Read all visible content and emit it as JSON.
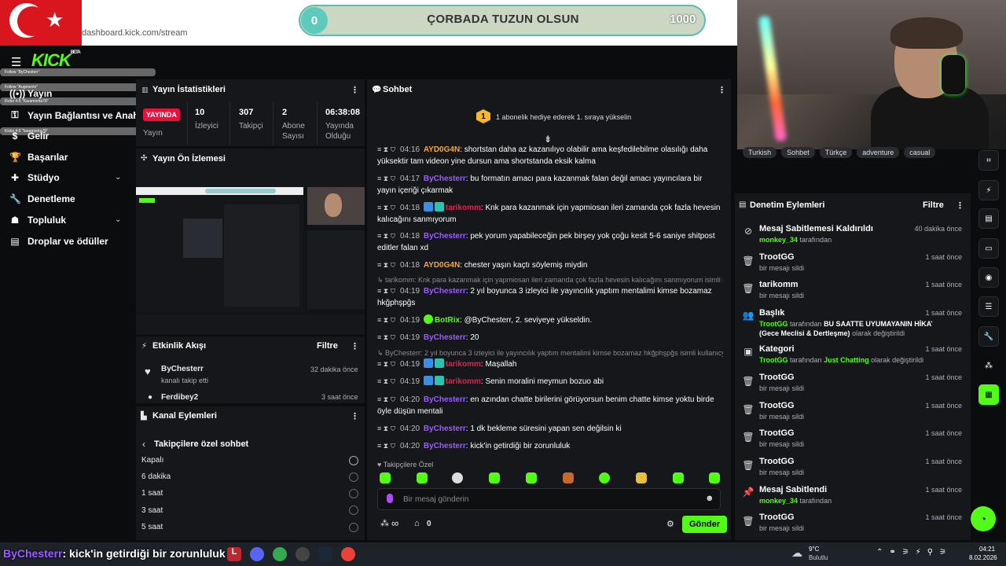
{
  "browser": {
    "url": "dashboard.kick.com/stream"
  },
  "goal": {
    "min": "0",
    "max": "1000",
    "title": "ÇORBADA TUZUN OLSUN"
  },
  "alerts": [
    "Follow \"ByChesterr\"",
    "Follow \"Augmentx\"",
    "Kicks 4-5 \"Karamonta78\"",
    "Kicks 4-5 \"karamonta78\""
  ],
  "nav": {
    "logo": "KICK",
    "logo_beta": "BETA",
    "items": [
      {
        "label": "Yayın"
      },
      {
        "label": "Yayın Bağlantısı ve Anahtarı"
      },
      {
        "label": "Gelir"
      },
      {
        "label": "Başarılar"
      },
      {
        "label": "Stüdyo"
      },
      {
        "label": "Denetleme"
      },
      {
        "label": "Topluluk"
      },
      {
        "label": "Droplar ve ödüller"
      }
    ]
  },
  "stats": {
    "title": "Yayın İstatistikleri",
    "live_badge": "YAYINDA",
    "status_label": "Yayın",
    "viewers": {
      "value": "10",
      "label": "İzleyici"
    },
    "followers": {
      "value": "307",
      "label": "Takipçi"
    },
    "subs": {
      "value": "2",
      "label": "Abone Sayısı"
    },
    "uptime": {
      "value": "06:38:08",
      "label": "Yayında Olduğu"
    }
  },
  "preview": {
    "title": "Yayın Ön İzlemesi"
  },
  "activity": {
    "title": "Etkinlik Akışı",
    "filter": "Filtre",
    "items": [
      {
        "user": "ByChesterr",
        "desc": "kanalı takip etti",
        "time": "32 dakika önce"
      },
      {
        "user": "Ferdibey2",
        "desc": "",
        "time": "3 saat önce"
      }
    ]
  },
  "kanal": {
    "title": "Kanal Eylemleri",
    "back": "Takipçilere özel sohbet",
    "options": [
      "Kapalı",
      "6 dakika",
      "1 saat",
      "3 saat",
      "5 saat"
    ]
  },
  "chat": {
    "title": "Sohbet",
    "gift_rank": "1",
    "gift_text": "1 abonelik hediye ederek 1. sıraya yükselin",
    "messages": [
      {
        "time": "04:16",
        "user": "AYD0G4N",
        "text": "shortstan daha az kazanılıyo olabilir ama keşfedilebilme olasılığı daha yüksektir tam videon yine dursun ama shortstanda eksik kalma"
      },
      {
        "time": "04:17",
        "user": "ByChesterr",
        "text": "bu formatın amacı para kazanmak falan değil amacı yayıncılara bir yayın içeriği çıkarmak"
      },
      {
        "time": "04:18",
        "user": "tarikomm",
        "text": "Knk para kazanmak için yapmiosan ileri zamanda çok fazla hevesin kalıcağını sanmıyorum"
      },
      {
        "time": "04:18",
        "user": "ByChesterr",
        "text": "pek yorum yapabileceğin pek birşey yok çoğu kesit 5-6 saniye shitpost editler falan xd"
      },
      {
        "time": "04:18",
        "user": "AYD0G4N",
        "text": "chester yaşın kaçtı söylemiş miydin"
      },
      {
        "time": "04:19",
        "user": "ByChesterr",
        "text": "2 yıl boyunca 3 izleyici ile yayıncılık yaptım mentalimi kimse bozamaz hkğphşpğs"
      },
      {
        "time": "04:19",
        "user": "BotRix",
        "text": "@ByChesterr, 2. seviyeye yükseldin."
      },
      {
        "time": "04:19",
        "user": "ByChesterr",
        "text": "20"
      },
      {
        "time": "04:19",
        "user": "tarikomm",
        "text": "Maşallah"
      },
      {
        "time": "04:19",
        "user": "tarikomm",
        "text": "Senin moralini meymun bozuo abi"
      },
      {
        "time": "04:20",
        "user": "ByChesterr",
        "text": "en azından chatte birilerini görüyorsun benim chatte kimse yoktu birde öyle düşün mentali"
      },
      {
        "time": "04:20",
        "user": "ByChesterr",
        "text": "1 dk bekleme süresini yapan sen değilsin ki"
      },
      {
        "time": "04:20",
        "user": "ByChesterr",
        "text": "kick'in getirdiği bir zorunluluk"
      }
    ],
    "reply1": "↳ tarikomm: Knk para kazanmak için yapmiosan ileri zamanda çok fazla hevesin kalıcağını sanmıyorum isimli ku...",
    "reply2": "↳ ByChesterr: 2 yıl boyunca 3 izleyici ile yayıncılık yaptım mentalimi kimse bozamaz hkğphşpğs isimli kullanıcy...",
    "followers_only": "♥ Takipçilere Özel",
    "placeholder": "Bir mesaj gönderin",
    "points": "∞",
    "store_count": "0",
    "send": "Gönder"
  },
  "tags": [
    "Turkish",
    "Sohbet",
    "Türkçe",
    "adventure",
    "casual"
  ],
  "modlog": {
    "title": "Denetim Eylemleri",
    "filter": "Filtre",
    "items": [
      {
        "icon": "unpin-icon",
        "title": "Mesaj Sabitlemesi Kaldırıldı",
        "actor": "monkey_34",
        "sub": "tarafından",
        "time": "40 dakika önce"
      },
      {
        "icon": "trash-icon",
        "title": "TrootGG",
        "sub": "bir mesajı sildi",
        "time": "1 saat önce"
      },
      {
        "icon": "trash-icon",
        "title": "tarikomm",
        "sub": "bir mesajı sildi",
        "time": "1 saat önce"
      },
      {
        "icon": "users-icon",
        "title": "Başlık",
        "actor": "TrootGG",
        "sub": "tarafından",
        "extra": "BU SAATTE UYUMAYANIN HİKAYESİ VARDIR...",
        "line2": "(Gece Meclisi & Dertleşme)",
        "line2b": "olarak değiştirildi",
        "time": "1 saat önce"
      },
      {
        "icon": "category-icon",
        "title": "Kategori",
        "actor": "TrootGG",
        "sub": "tarafından",
        "extra": "Just Chatting",
        "extra2": "olarak değiştirildi",
        "time": "1 saat önce"
      },
      {
        "icon": "trash-icon",
        "title": "TrootGG",
        "sub": "bir mesajı sildi",
        "time": "1 saat önce"
      },
      {
        "icon": "trash-icon",
        "title": "TrootGG",
        "sub": "bir mesajı sildi",
        "time": "1 saat önce"
      },
      {
        "icon": "trash-icon",
        "title": "TrootGG",
        "sub": "bir mesajı sildi",
        "time": "1 saat önce"
      },
      {
        "icon": "trash-icon",
        "title": "TrootGG",
        "sub": "bir mesajı sildi",
        "time": "1 saat önce"
      },
      {
        "icon": "pin-icon",
        "title": "Mesaj Sabitlendi",
        "actor": "monkey_34",
        "sub": "tarafından",
        "time": "1 saat önce"
      },
      {
        "icon": "trash-icon",
        "title": "TrootGG",
        "sub": "bir mesajı sildi",
        "time": "1 saat önce"
      }
    ]
  },
  "overlay": {
    "user": "ByChesterr",
    "text": ": kick'in getirdiği bir zorunluluk"
  },
  "taskbar": {
    "temp": "9°C",
    "weather": "Bulutlu",
    "time": "04:21",
    "date": "8.02.2026"
  },
  "colors": {
    "accent": "#53fc18",
    "live": "#e9113c",
    "purple": "#9b5cff",
    "orange": "#f7a738",
    "red": "#e81f4a"
  }
}
